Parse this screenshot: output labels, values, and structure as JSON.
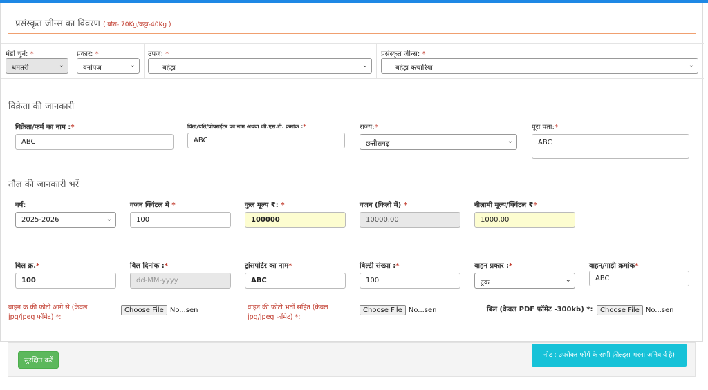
{
  "title": {
    "main": "प्रसंस्कृत जीन्स का विवरण",
    "note": "( बोरा- 70Kg/कट्टा-40Kg )"
  },
  "selection": {
    "mandi": {
      "label": "मंडी चुनें:",
      "value": "धमतरी"
    },
    "prakar": {
      "label": "प्रकार:",
      "value": "वनोपज"
    },
    "upaj": {
      "label": "उपज:",
      "value": "बहेड़ा"
    },
    "jeens": {
      "label": "प्रसंस्कृत जीन्स:",
      "value": "बहेड़ा कचारिया"
    }
  },
  "seller": {
    "section_title": "विक्रेता की जानकारी",
    "name": {
      "label": "विक्रेता/फर्म का नाम :",
      "value": "ABC"
    },
    "father": {
      "label": "पिता/पति/प्रोपराईटर का नाम अथवा जी.एस.टी. क्रमांक :",
      "value": "ABC"
    },
    "state": {
      "label": "राज्य:",
      "value": "छत्तीसगढ़"
    },
    "address": {
      "label": "पूरा पता:",
      "value": "ABC"
    }
  },
  "weighing": {
    "section_title": "तौल की जानकारी भरें",
    "year": {
      "label": "वर्ष:",
      "value": "2025-2026"
    },
    "weight_quintal": {
      "label": "वजन क्विंटल में",
      "value": "100"
    },
    "total_price": {
      "label": "कुल मूल्य ₹:",
      "value": "100000"
    },
    "weight_kg": {
      "label": "वजन (किलो में)",
      "value": "10000.00"
    },
    "auction_price": {
      "label": "नीलामी मूल्य/क्विंटल ₹",
      "value": "1000.00"
    },
    "bill_no": {
      "label": "बिल क्र.",
      "value": "100"
    },
    "bill_date": {
      "label": "बिल दिनांक :",
      "placeholder": "dd-MM-yyyy"
    },
    "transporter": {
      "label": "ट्रांसपोर्टर का नाम",
      "value": "ABC"
    },
    "bilty_no": {
      "label": "बिल्टी संख्या :",
      "value": "100"
    },
    "vehicle_type": {
      "label": "वाहन प्रकार :",
      "value": "ट्रक"
    },
    "vehicle_no": {
      "label": "वाहन/गाड़ी क्रमांक",
      "value": "ABC"
    }
  },
  "uploads": {
    "front_photo": {
      "label_line1": "वाहन क्र की फोटो आगे से (केवल",
      "label_line2": "jpg/jpeg फॉमेट) *:"
    },
    "loaded_photo": {
      "label_line1": "वाहन की फोटो भर्ती सहित (केवल",
      "label_line2": "jpg/jpeg फॉमेट) *:"
    },
    "bill_pdf": {
      "label": "बिल (केवल PDF फॉमेट -300kb) *:"
    },
    "button_label": "Choose File",
    "status": "No...sen"
  },
  "footer": {
    "save_label": "सुरक्षित करें",
    "note": "नोट : उपरोक्त फॉर्म के सभी फ़ील्ड्स भरना अनिवार्य है)"
  },
  "required_mark": "*",
  "chevron": "⌄"
}
